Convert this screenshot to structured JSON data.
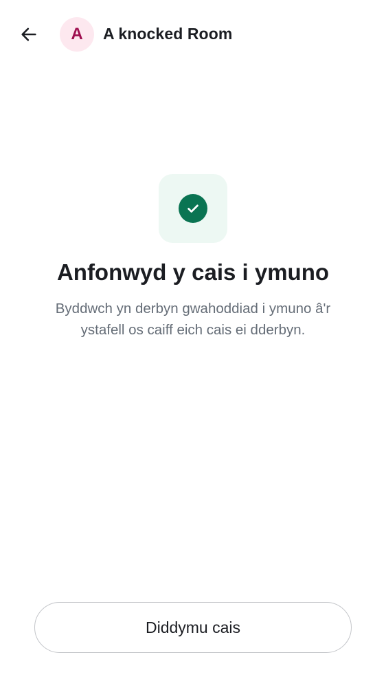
{
  "header": {
    "back_icon": "arrow-left-icon",
    "avatar_letter": "A",
    "room_name": "A knocked Room"
  },
  "status": {
    "icon": "check-circle-icon",
    "title": "Anfonwyd y cais i ymuno",
    "description": "Byddwch yn derbyn gwahoddiad i ymuno â'r ystafell os caiff eich cais ei dderbyn."
  },
  "actions": {
    "cancel_label": "Diddymu cais"
  },
  "colors": {
    "avatar_bg": "#fde8ef",
    "avatar_text": "#9e0f4f",
    "success_tile_bg": "#edf8f3",
    "success_accent": "#0a7452",
    "primary_text": "#1b1d22",
    "secondary_text": "#656d77",
    "button_border": "#c3c5c9"
  }
}
